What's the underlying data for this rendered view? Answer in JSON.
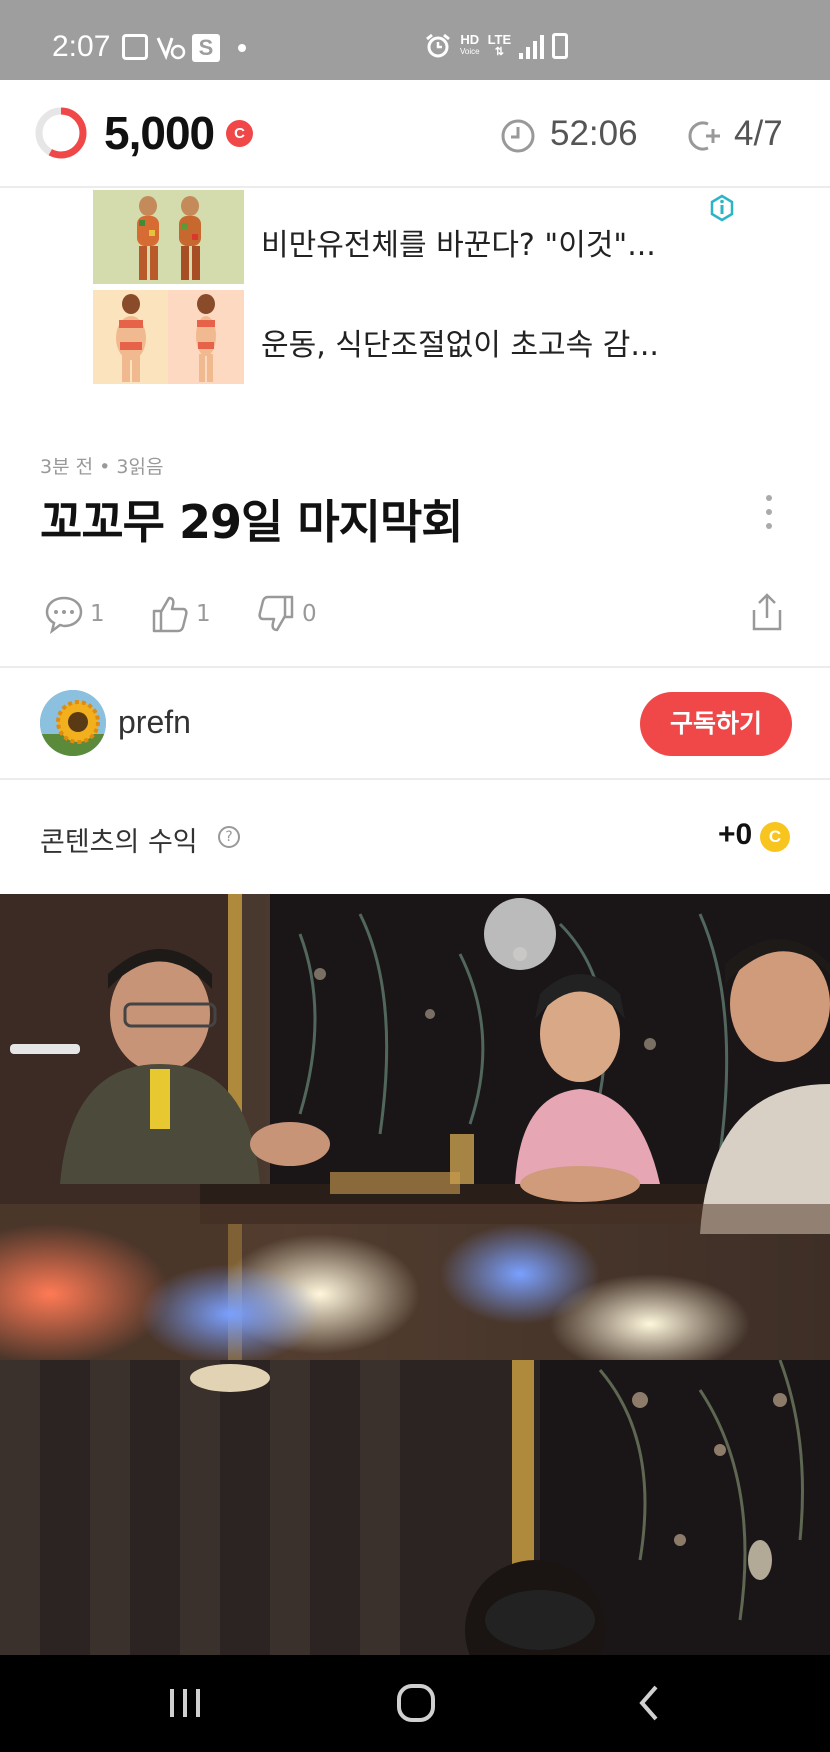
{
  "status_bar": {
    "time": "2:07",
    "hd_label": "HD",
    "voice_label": "Voice",
    "lte_label": "LTE",
    "s_badge": "S"
  },
  "app_bar": {
    "points": "5,000",
    "coin_symbol": "C",
    "timer": "52:06",
    "progress": "4/7",
    "ring_progress": 0.58,
    "accent": "#f04848"
  },
  "ads": [
    {
      "text": "비만유전체를 바꾼다? \"이것\"..."
    },
    {
      "text": "운동, 식단조절없이 초고속 감..."
    }
  ],
  "post": {
    "meta": "3분 전 • 3읽음",
    "title": "꼬꼬무 29일 마지막회",
    "comments": "1",
    "likes": "1",
    "dislikes": "0"
  },
  "author": {
    "name": "prefn",
    "subscribe_label": "구독하기"
  },
  "earnings": {
    "label": "콘텐츠의 수익",
    "help_symbol": "?",
    "value": "+0",
    "coin_symbol": "C"
  },
  "icons": {
    "clock": "clock-icon",
    "coin_plus": "coin-plus-icon",
    "comment": "comment-icon",
    "like": "thumbs-up-icon",
    "dislike": "thumbs-down-icon",
    "share": "share-icon",
    "more": "more-vertical-icon"
  },
  "colors": {
    "red": "#f04848",
    "gold": "#f7c51e",
    "status_bar": "#9e9e9e"
  }
}
